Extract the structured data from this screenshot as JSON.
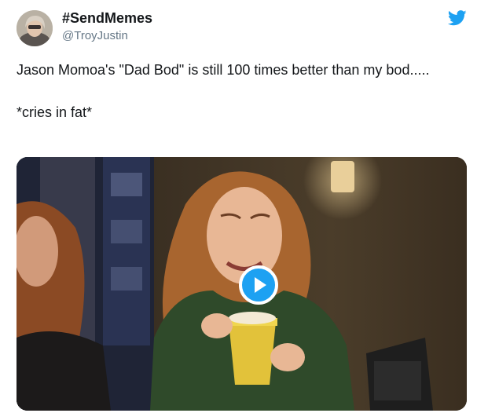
{
  "tweet": {
    "display_name": "#SendMemes",
    "handle": "@TroyJustin",
    "text": "Jason Momoa's \"Dad Bod\" is still 100 times better than my bod.....\n\n*cries in fat*"
  },
  "icons": {
    "brand": "twitter-bird-icon",
    "play": "play-icon"
  },
  "colors": {
    "twitter_blue": "#1da1f2",
    "handle_gray": "#657786",
    "text": "#14171a"
  }
}
